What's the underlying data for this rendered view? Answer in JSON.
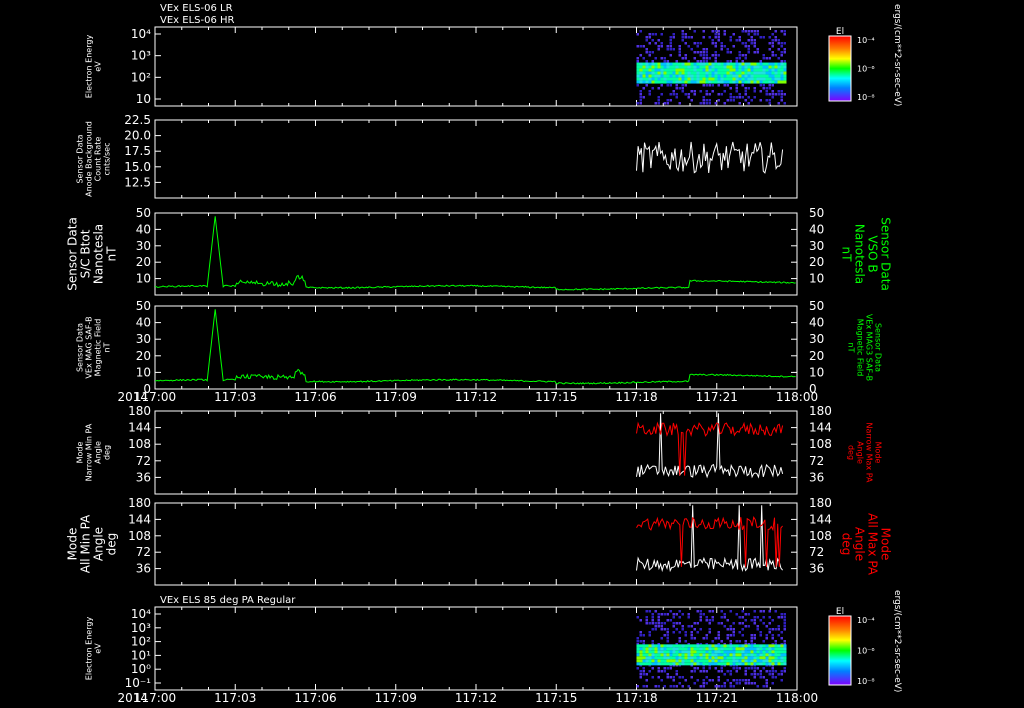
{
  "colors": {
    "background": "#000000",
    "axis": "#ffffff",
    "green": "#00ff00",
    "red": "#ff0000",
    "white": "#ffffff"
  },
  "headers": {
    "top_line1": "VEx ELS-06 LR",
    "top_line2": "VEx ELS-06 HR",
    "panel7": "VEx ELS 85 deg PA Regular"
  },
  "time_axis": {
    "year_label": "2014",
    "ticks": [
      "117:00",
      "117:03",
      "117:06",
      "117:09",
      "117:12",
      "117:15",
      "117:18",
      "117:21",
      "118:00"
    ]
  },
  "colorbar": {
    "title": "El",
    "ticks": [
      "10⁻⁴",
      "10⁻⁶",
      "10⁻⁸"
    ],
    "unit_label": "ergs/(cm**2-sr-sec-eV)"
  },
  "chart_data": [
    {
      "id": "p1",
      "type": "heatmap",
      "ylabel": [
        "Electron Energy",
        "eV"
      ],
      "yticks": [
        "10⁴",
        "10³",
        "10²",
        "10"
      ],
      "data_span": [
        "117:18",
        "117:23:30"
      ],
      "colorbar": true
    },
    {
      "id": "p2",
      "type": "line",
      "ylabel": [
        "Sensor Data",
        "Anode Background",
        "Count Rate",
        "cnts/sec"
      ],
      "ylim": [
        10,
        22.5
      ],
      "yticks": [
        "22.5",
        "20.0",
        "17.5",
        "15.0",
        "12.5"
      ],
      "series": [
        {
          "color": "#ffffff",
          "data_span": [
            "117:18",
            "117:23:30"
          ],
          "baseline": 16.5,
          "amplitude": 2.5
        }
      ]
    },
    {
      "id": "p3",
      "type": "line",
      "ylabel": [
        "Sensor Data",
        "S/C Btot",
        "Nanotesla",
        "nT"
      ],
      "ylabel_right": [
        "Sensor Data",
        "VSO B",
        "Nanotesla",
        "nT"
      ],
      "ylim": [
        0,
        50
      ],
      "yticks": [
        "50",
        "40",
        "30",
        "20",
        "10"
      ],
      "series": [
        {
          "color": "#00ff00",
          "baseline": 5,
          "spike_at": "117:02:15",
          "spike_value": 48
        }
      ]
    },
    {
      "id": "p4",
      "type": "line",
      "ylabel": [
        "Sensor Data",
        "VEx MAG SAF-B",
        "Magnetic Field",
        "nT"
      ],
      "ylabel_right": [
        "Sensor Data",
        "VEx MAG3 SAF-B",
        "Magnetic Field",
        "nT"
      ],
      "ylim": [
        0,
        50
      ],
      "yticks": [
        "50",
        "40",
        "30",
        "20",
        "10",
        "0"
      ],
      "series": [
        {
          "color": "#00ff00",
          "baseline": 5,
          "spike_at": "117:02:15",
          "spike_value": 48
        }
      ]
    },
    {
      "id": "p5",
      "type": "line",
      "ylabel": [
        "Mode",
        "Narrow Min PA",
        "Angle",
        "deg"
      ],
      "ylabel_right": [
        "Mode",
        "Narrow Max PA",
        "Angle",
        "deg"
      ],
      "ylim": [
        0,
        180
      ],
      "yticks": [
        "180",
        "144",
        "108",
        "72",
        "36"
      ],
      "series": [
        {
          "name": "Min PA",
          "color": "#ffffff",
          "data_span": [
            "117:18",
            "117:23:30"
          ],
          "baseline": 50
        },
        {
          "name": "Max PA",
          "color": "#ff0000",
          "data_span": [
            "117:18",
            "117:23:30"
          ],
          "baseline": 140
        }
      ]
    },
    {
      "id": "p6",
      "type": "line",
      "ylabel": [
        "Mode",
        "All Min PA",
        "Angle",
        "deg"
      ],
      "ylabel_right": [
        "Mode",
        "All Max PA",
        "Angle",
        "deg"
      ],
      "ylim": [
        0,
        180
      ],
      "yticks": [
        "180",
        "144",
        "108",
        "72",
        "36"
      ],
      "series": [
        {
          "name": "Min PA",
          "color": "#ffffff",
          "data_span": [
            "117:18",
            "117:23:30"
          ],
          "baseline": 45
        },
        {
          "name": "Max PA",
          "color": "#ff0000",
          "data_span": [
            "117:18",
            "117:23:30"
          ],
          "baseline": 135
        }
      ]
    },
    {
      "id": "p7",
      "type": "heatmap",
      "ylabel": [
        "Electron Energy",
        "eV"
      ],
      "yticks": [
        "10⁴",
        "10³",
        "10²",
        "10¹",
        "10⁰",
        "10⁻¹"
      ],
      "data_span": [
        "117:18",
        "117:23:30"
      ],
      "colorbar": true
    }
  ]
}
